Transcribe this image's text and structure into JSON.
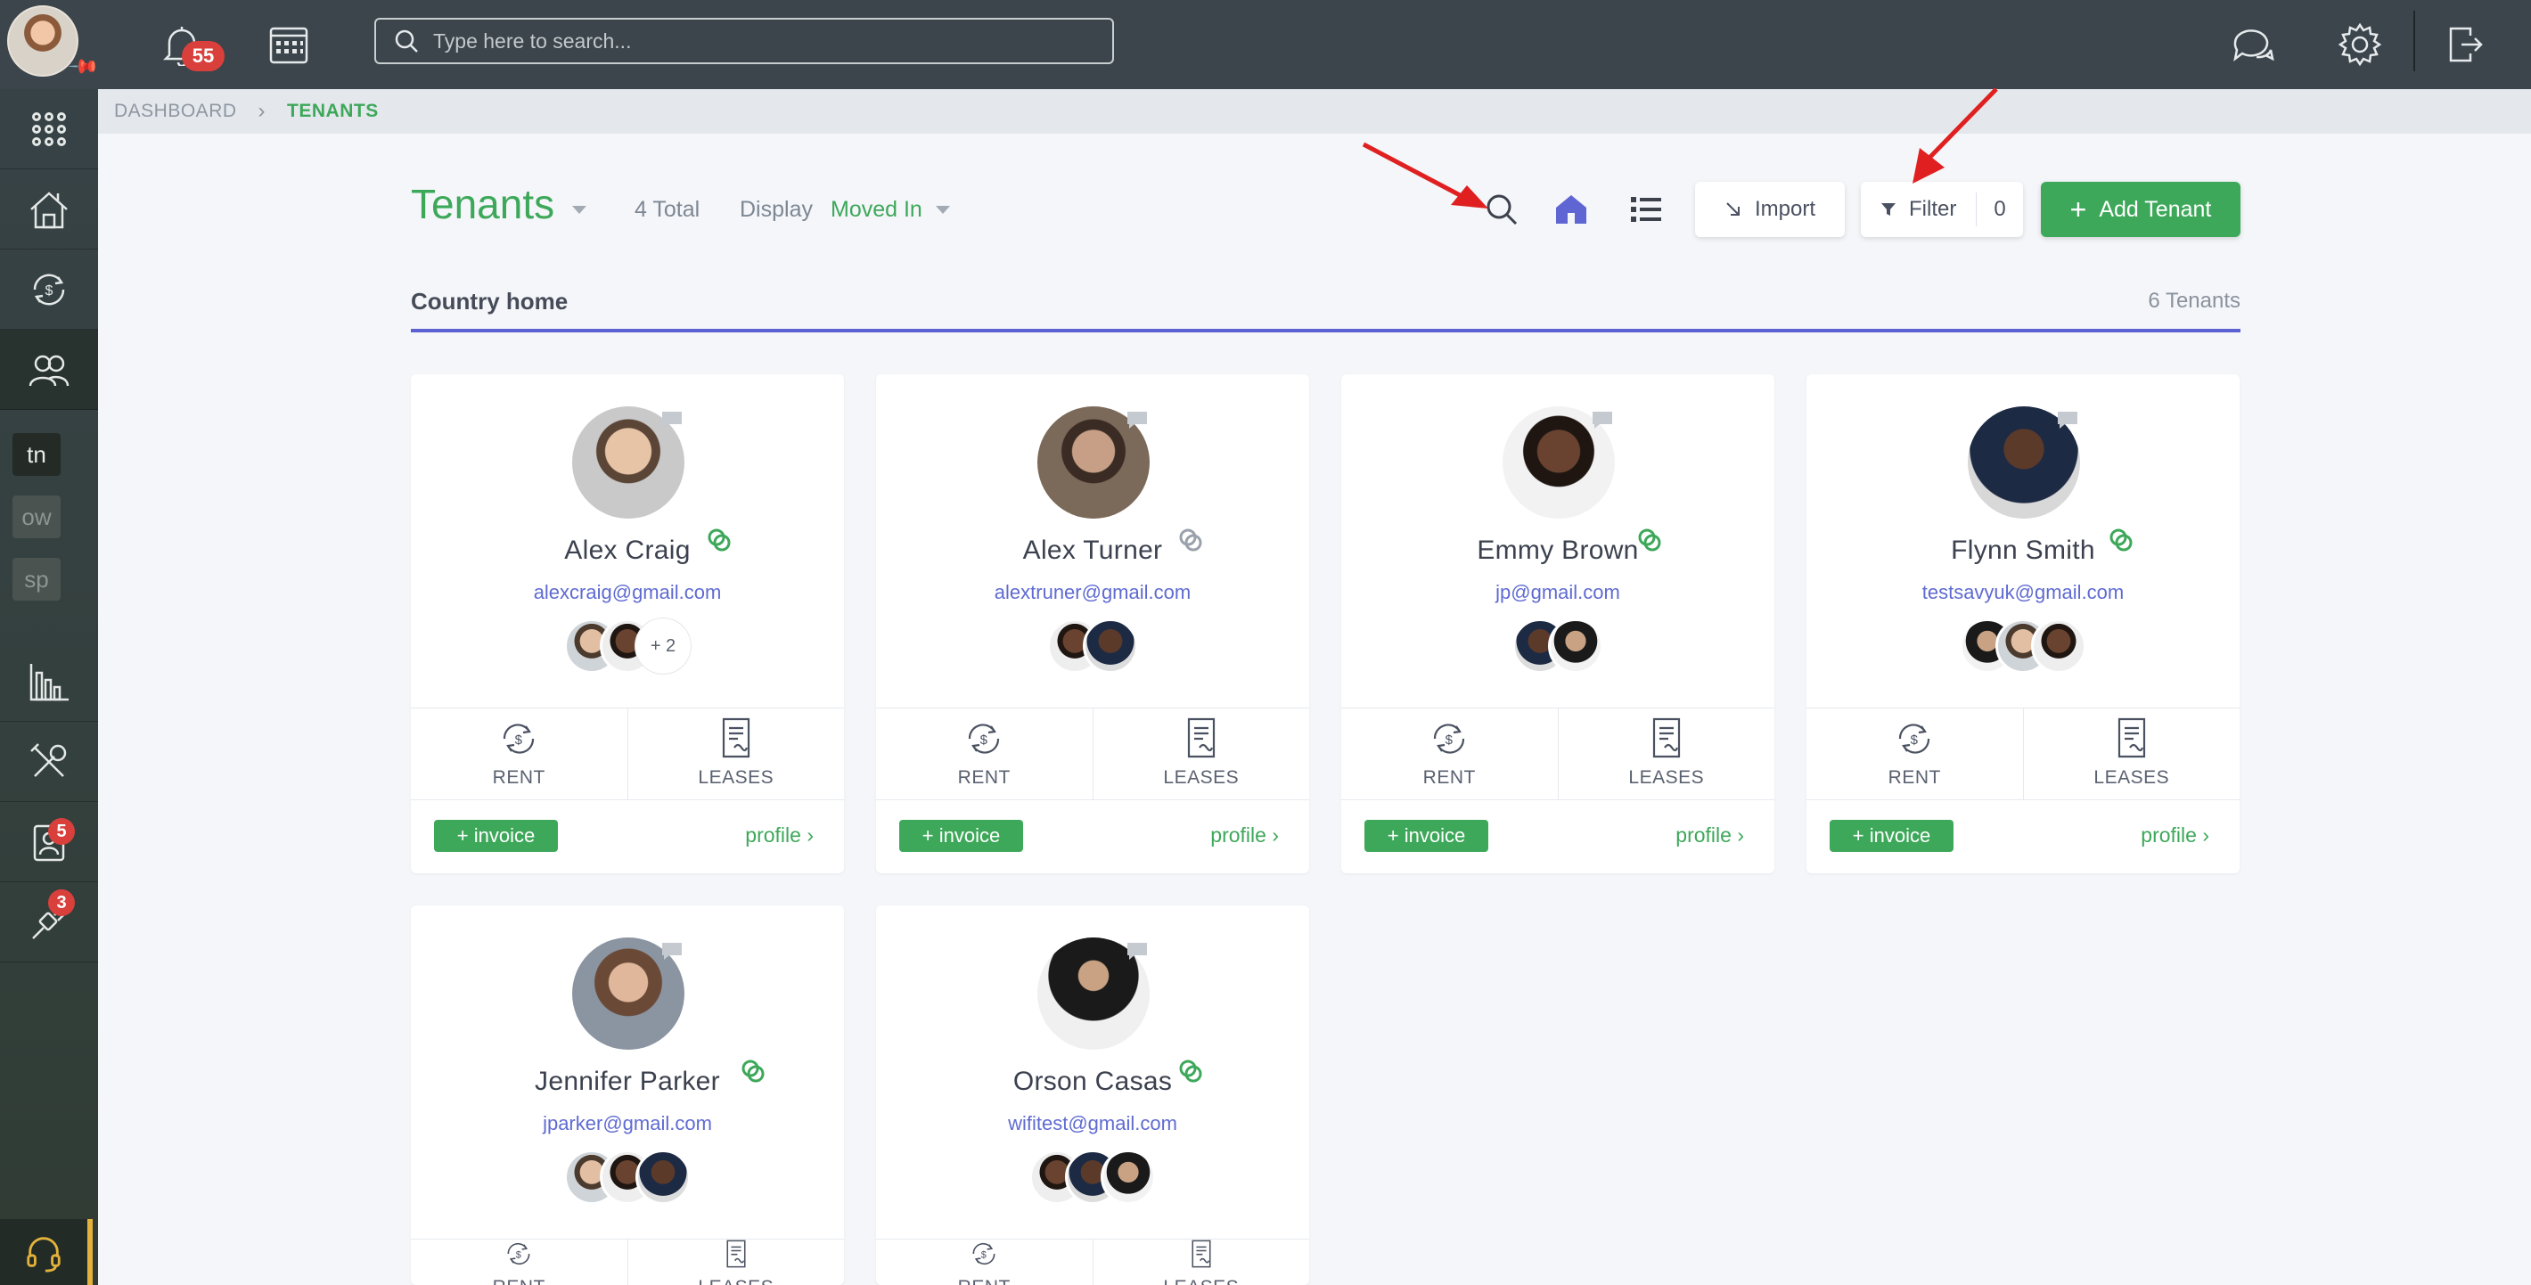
{
  "app": {
    "notifications_count": "55",
    "search_placeholder": "Type here to search..."
  },
  "sidebar": {
    "tags": [
      "tn",
      "ow",
      "sp"
    ],
    "badges": {
      "people_badge": "5",
      "tools_badge": "3"
    }
  },
  "breadcrumb": {
    "root": "DASHBOARD",
    "current": "TENANTS"
  },
  "header": {
    "title": "Tenants",
    "total": "4 Total",
    "display_label": "Display",
    "display_value": "Moved In",
    "import_label": "Import",
    "filter_label": "Filter",
    "filter_count": "0",
    "add_label": "Add Tenant"
  },
  "group": {
    "name": "Country home",
    "count": "6 Tenants"
  },
  "card_labels": {
    "rent": "RENT",
    "leases": "LEASES",
    "invoice": "+ invoice",
    "profile": "profile"
  },
  "tenants": [
    {
      "name": "Alex Craig",
      "email": "alexcraig@gmail.com",
      "lease_more": "+ 2"
    },
    {
      "name": "Alex Turner",
      "email": "alextruner@gmail.com"
    },
    {
      "name": "Emmy Brown",
      "email": "jp@gmail.com"
    },
    {
      "name": "Flynn Smith",
      "email": "testsavyuk@gmail.com"
    },
    {
      "name": "Jennifer Parker",
      "email": "jparker@gmail.com"
    },
    {
      "name": "Orson Casas",
      "email": "wifitest@gmail.com"
    }
  ],
  "colors": {
    "brand_green": "#3ea85a",
    "accent_blue": "#5b61d1",
    "badge_red": "#d9403c",
    "sidebar": "#374247"
  }
}
